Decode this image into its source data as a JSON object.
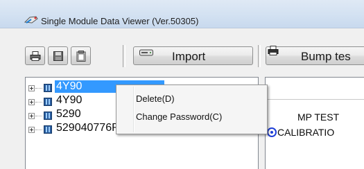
{
  "window": {
    "title": "Single Module Data Viewer (Ver.50305)",
    "icon": "app-icon"
  },
  "toolbar": {
    "print_icon": "printer-icon",
    "save_icon": "save-disk-icon",
    "clipboard_icon": "clipboard-icon",
    "import_label": "Import",
    "import_icon": "drive-icon",
    "bump_label": "Bump tes",
    "bump_icon": "printer-icon"
  },
  "tree": {
    "items": [
      {
        "label": "4Y90",
        "selected": true
      },
      {
        "label": "4Y90",
        "selected": false
      },
      {
        "label": "5290",
        "selected": false
      },
      {
        "label": "529040776RN",
        "selected": false
      }
    ]
  },
  "context_menu": {
    "items": [
      {
        "label": "Delete(D)"
      },
      {
        "label": "Change Password(C)"
      }
    ]
  },
  "right_panel": {
    "bump_text": "MP TEST",
    "calibration_text": "CALIBRATIO"
  },
  "colors": {
    "selection": "#3399ff",
    "calibration_icon": "#1f3fd8"
  }
}
